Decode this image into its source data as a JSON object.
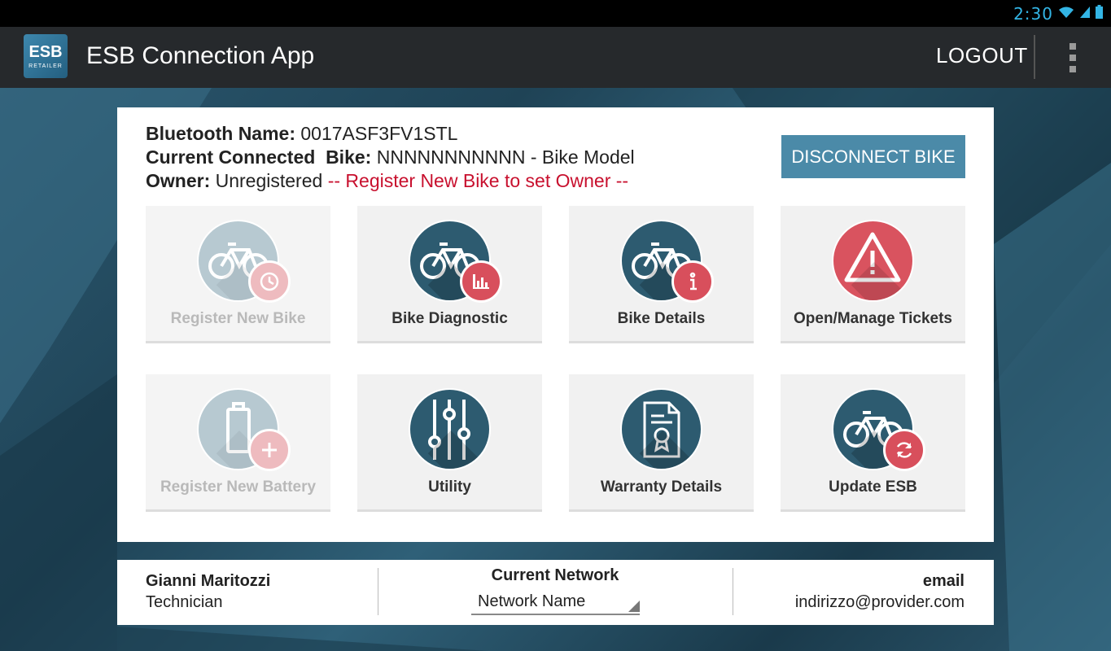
{
  "statusbar": {
    "time": "2:30",
    "wifi_icon": "wifi-icon",
    "signal_icon": "signal-icon",
    "battery_icon": "battery-icon"
  },
  "actionbar": {
    "logo_mark": "ESB",
    "logo_sub": "RETAILER",
    "title": "ESB Connection App",
    "logout_label": "LOGOUT",
    "overflow_icon": "more-vert-icon"
  },
  "info": {
    "bluetooth_label": "Bluetooth Name:",
    "bluetooth_value": "0017ASF3FV1STL",
    "bike_label": "Current Connected  Bike:",
    "bike_value": "NNNNNNNNNNN - Bike Model",
    "owner_label": "Owner:",
    "owner_value": "Unregistered",
    "owner_hint": "-- Register New Bike to set Owner --"
  },
  "disconnect_label": "DISCONNECT BIKE",
  "tiles": [
    {
      "label": "Register New Bike",
      "icon": "bike-icon",
      "badge_icon": "clock-icon",
      "enabled": false
    },
    {
      "label": "Bike Diagnostic",
      "icon": "bike-icon",
      "badge_icon": "bar-chart-icon",
      "enabled": true
    },
    {
      "label": "Bike Details",
      "icon": "bike-icon",
      "badge_icon": "info-icon",
      "enabled": true
    },
    {
      "label": "Open/Manage Tickets",
      "icon": "warning-icon",
      "enabled": true
    },
    {
      "label": "Register New Battery",
      "icon": "battery-icon",
      "badge_icon": "plus-icon",
      "enabled": false
    },
    {
      "label": "Utility",
      "icon": "sliders-icon",
      "enabled": true
    },
    {
      "label": "Warranty Details",
      "icon": "certificate-icon",
      "enabled": true
    },
    {
      "label": "Update ESB",
      "icon": "bike-icon",
      "badge_icon": "refresh-icon",
      "enabled": true
    }
  ],
  "footer": {
    "user_name": "Gianni Maritozzi",
    "user_role": "Technician",
    "network_title": "Current Network",
    "network_value": "Network Name",
    "email_title": "email",
    "email_value": "indirizzo@provider.com"
  },
  "colors": {
    "accent": "#4b8aa8",
    "badge_red": "#d84f5c",
    "circle_dark": "#2d5b70",
    "warning_red": "#c8102e"
  }
}
